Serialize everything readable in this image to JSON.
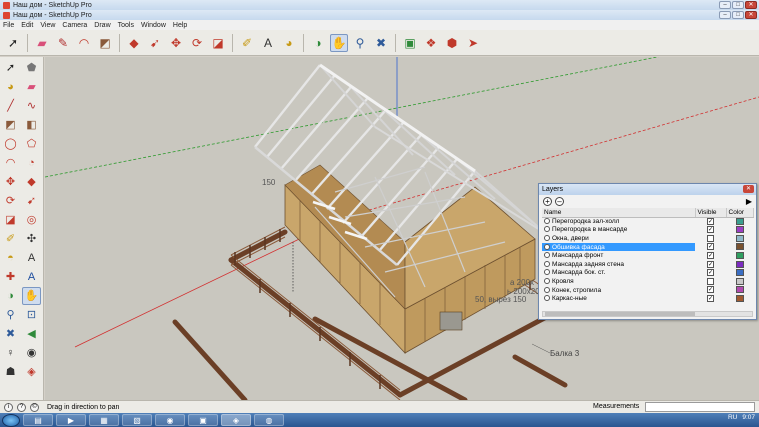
{
  "titlebars": [
    {
      "title": "Наш дом - SketchUp Pro"
    },
    {
      "title": "Наш дом - SketchUp Pro"
    }
  ],
  "window_buttons": {
    "minimize": "–",
    "maximize": "□",
    "close": "✕"
  },
  "menu": [
    "File",
    "Edit",
    "View",
    "Camera",
    "Draw",
    "Tools",
    "Window",
    "Help"
  ],
  "toolbar": [
    {
      "name": "select-icon",
      "glyph": "➚",
      "color": "#222222"
    },
    {
      "name": "eraser-icon",
      "glyph": "▰",
      "color": "#d9507a"
    },
    {
      "name": "pencil-icon",
      "glyph": "✎",
      "color": "#b03030"
    },
    {
      "name": "arc-icon",
      "glyph": "◠",
      "color": "#c0392b"
    },
    {
      "name": "shapes-icon",
      "glyph": "◩",
      "color": "#8a5a3b"
    },
    {
      "name": "push-pull-icon",
      "glyph": "◆",
      "color": "#c0392b"
    },
    {
      "name": "follow-me-icon",
      "glyph": "➹",
      "color": "#c0392b"
    },
    {
      "name": "move-icon",
      "glyph": "✥",
      "color": "#c0392b"
    },
    {
      "name": "rotate-icon",
      "glyph": "⟳",
      "color": "#c0392b"
    },
    {
      "name": "scale-icon",
      "glyph": "◪",
      "color": "#c0392b"
    },
    {
      "name": "tape-measure-icon",
      "glyph": "✐",
      "color": "#c79a16"
    },
    {
      "name": "text-icon",
      "glyph": "A",
      "color": "#333333"
    },
    {
      "name": "paint-bucket-icon",
      "glyph": "◕",
      "color": "#c79a16"
    },
    {
      "name": "orbit-icon",
      "glyph": "◑",
      "color": "#2f8a3a"
    },
    {
      "name": "pan-icon",
      "glyph": "✋",
      "color": "#444444"
    },
    {
      "name": "zoom-icon",
      "glyph": "⚲",
      "color": "#2f5b9a"
    },
    {
      "name": "zoom-extents-icon",
      "glyph": "✖",
      "color": "#2f5b9a"
    },
    {
      "name": "warehouse-icon",
      "glyph": "▣",
      "color": "#2f8a3a"
    },
    {
      "name": "components-icon",
      "glyph": "❖",
      "color": "#c0392b"
    },
    {
      "name": "extension-icon",
      "glyph": "⬢",
      "color": "#c0392b"
    },
    {
      "name": "send-icon",
      "glyph": "➤",
      "color": "#c0392b"
    }
  ],
  "left_tools": [
    {
      "name": "select-icon",
      "glyph": "➚",
      "color": "#222222"
    },
    {
      "name": "make-component-icon",
      "glyph": "⬟",
      "color": "#777777"
    },
    {
      "name": "paint-bucket-icon",
      "glyph": "◕",
      "color": "#c79a16"
    },
    {
      "name": "eraser-icon",
      "glyph": "▰",
      "color": "#d9507a"
    },
    {
      "name": "line-icon",
      "glyph": "╱",
      "color": "#b03030"
    },
    {
      "name": "freehand-icon",
      "glyph": "∿",
      "color": "#b03030"
    },
    {
      "name": "rectangle-icon",
      "glyph": "◩",
      "color": "#8a5a3b"
    },
    {
      "name": "rotated-rectangle-icon",
      "glyph": "◧",
      "color": "#8a5a3b"
    },
    {
      "name": "circle-icon",
      "glyph": "◯",
      "color": "#c0392b"
    },
    {
      "name": "polygon-icon",
      "glyph": "⬠",
      "color": "#c0392b"
    },
    {
      "name": "arc-icon",
      "glyph": "◠",
      "color": "#c0392b"
    },
    {
      "name": "pie-icon",
      "glyph": "◔",
      "color": "#c0392b"
    },
    {
      "name": "move-icon",
      "glyph": "✥",
      "color": "#c0392b"
    },
    {
      "name": "push-pull-icon",
      "glyph": "◆",
      "color": "#c0392b"
    },
    {
      "name": "rotate-icon",
      "glyph": "⟳",
      "color": "#c0392b"
    },
    {
      "name": "follow-me-icon",
      "glyph": "➹",
      "color": "#c0392b"
    },
    {
      "name": "scale-icon",
      "glyph": "◪",
      "color": "#c0392b"
    },
    {
      "name": "offset-icon",
      "glyph": "◎",
      "color": "#c0392b"
    },
    {
      "name": "tape-measure-icon",
      "glyph": "✐",
      "color": "#c79a16"
    },
    {
      "name": "dimension-icon",
      "glyph": "✣",
      "color": "#333333"
    },
    {
      "name": "protractor-icon",
      "glyph": "◓",
      "color": "#c79a16"
    },
    {
      "name": "text-icon",
      "glyph": "A",
      "color": "#333333"
    },
    {
      "name": "axes-icon",
      "glyph": "✚",
      "color": "#c0392b"
    },
    {
      "name": "3d-text-icon",
      "glyph": "A",
      "color": "#1f4fa0"
    },
    {
      "name": "orbit-icon",
      "glyph": "◑",
      "color": "#2f8a3a"
    },
    {
      "name": "pan-icon",
      "glyph": "✋",
      "color": "#444444"
    },
    {
      "name": "zoom-icon",
      "glyph": "⚲",
      "color": "#2f5b9a"
    },
    {
      "name": "zoom-window-icon",
      "glyph": "⊡",
      "color": "#2f5b9a"
    },
    {
      "name": "zoom-extents-icon",
      "glyph": "✖",
      "color": "#2f5b9a"
    },
    {
      "name": "previous-icon",
      "glyph": "◀",
      "color": "#2f8a3a"
    },
    {
      "name": "position-camera-icon",
      "glyph": "♀",
      "color": "#333333"
    },
    {
      "name": "look-around-icon",
      "glyph": "◉",
      "color": "#333333"
    },
    {
      "name": "walk-icon",
      "glyph": "☗",
      "color": "#333333"
    },
    {
      "name": "section-plane-icon",
      "glyph": "◈",
      "color": "#c0392b"
    }
  ],
  "viewport": {
    "labels": [
      {
        "text": "150"
      },
      {
        "text": "а 200х"
      },
      {
        "text": "ь 200х200"
      },
      {
        "text": "50, вырез 150"
      },
      {
        "text": "Балка 3"
      }
    ]
  },
  "layers": {
    "title": "Layers",
    "add": "+",
    "remove": "–",
    "details": "▶",
    "close": "✕",
    "headers": {
      "name": "Name",
      "visible": "Visible",
      "color": "Color"
    },
    "rows": [
      {
        "name": "Перегородка зал-холл",
        "visible": true,
        "color": "#3a9e8f",
        "selected": false
      },
      {
        "name": "Перегородка в мансарде",
        "visible": true,
        "color": "#9b3ec4",
        "selected": false
      },
      {
        "name": "Окна, двери",
        "visible": false,
        "color": "#8fb8c9",
        "selected": false
      },
      {
        "name": "Обшивка фасада",
        "visible": true,
        "color": "#7a5230",
        "selected": true
      },
      {
        "name": "Мансарда фронт",
        "visible": true,
        "color": "#2f9e60",
        "selected": false
      },
      {
        "name": "Мансарда задняя стена",
        "visible": true,
        "color": "#7c2cc0",
        "selected": false
      },
      {
        "name": "Мансарда бок. ст.",
        "visible": true,
        "color": "#3a6ec4",
        "selected": false
      },
      {
        "name": "Кровля",
        "visible": false,
        "color": "#c9c9c9",
        "selected": false
      },
      {
        "name": "Конек, стропила",
        "visible": true,
        "color": "#b04ab0",
        "selected": false
      },
      {
        "name": "Каркас-ные",
        "visible": true,
        "color": "#a05a30",
        "selected": false
      }
    ]
  },
  "status": {
    "text": "Drag in direction to pan",
    "measurements_label": "Measurements",
    "icons": [
      "i",
      "?",
      "©"
    ]
  },
  "taskbar": {
    "apps": [
      {
        "name": "explorer-icon",
        "glyph": "▤"
      },
      {
        "name": "media-icon",
        "glyph": "▶"
      },
      {
        "name": "folder-icon",
        "glyph": "▦"
      },
      {
        "name": "files-icon",
        "glyph": "▧"
      },
      {
        "name": "chrome-icon",
        "glyph": "◉"
      },
      {
        "name": "save-icon",
        "glyph": "▣"
      },
      {
        "name": "sketchup-icon",
        "glyph": "◈"
      },
      {
        "name": "browser-icon",
        "glyph": "◍"
      }
    ],
    "lang": "RU",
    "time": "9:07"
  },
  "colors": {
    "sky": "#c9c7bf",
    "wall": "#c9a66b",
    "fence": "#7a4a2e",
    "axis_red": "#d23030",
    "axis_green": "#2c9a2c",
    "axis_blue": "#3060d0",
    "selection": "#3399ff"
  }
}
